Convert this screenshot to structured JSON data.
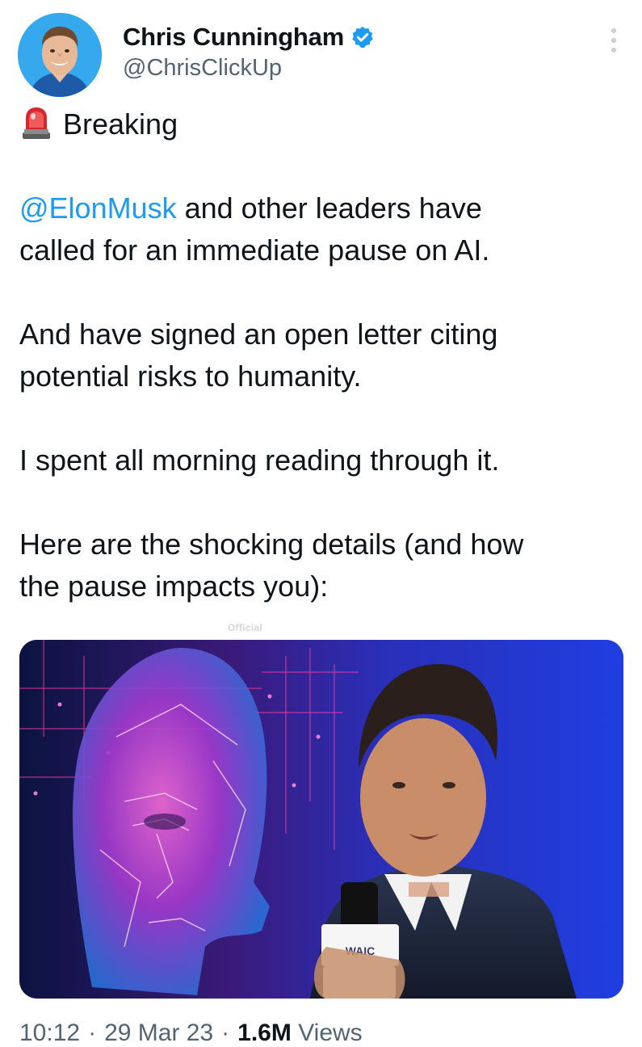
{
  "author": {
    "display_name": "Chris Cunningham",
    "handle": "@ChrisClickUp",
    "verified": true,
    "avatar_icon": "profile-photo"
  },
  "menu": {
    "icon": "more-vertical-icon"
  },
  "tweet": {
    "lead": {
      "emoji_icon": "police-siren-icon",
      "text": "Breaking"
    },
    "para1": {
      "mention": "@ElonMusk",
      "line1_rest": " and other leaders have",
      "line2": "called for an immediate pause on AI."
    },
    "para2": {
      "line1": "And have signed an open letter citing",
      "line2": "potential risks to humanity."
    },
    "para3": {
      "line1": "I spent all morning reading through it."
    },
    "para4": {
      "line1": "Here are the shocking details (and how",
      "line2": "the pause impacts you):"
    }
  },
  "media": {
    "watermark": "Official",
    "microphone_label": "WAIC"
  },
  "footer": {
    "time": "10:12",
    "date": "29 Mar 23",
    "views_count": "1.6M",
    "views_label": "Views",
    "separator": "·"
  },
  "colors": {
    "accent": "#1d9bf0",
    "secondary_text": "#536471",
    "primary_text": "#0f1419"
  }
}
